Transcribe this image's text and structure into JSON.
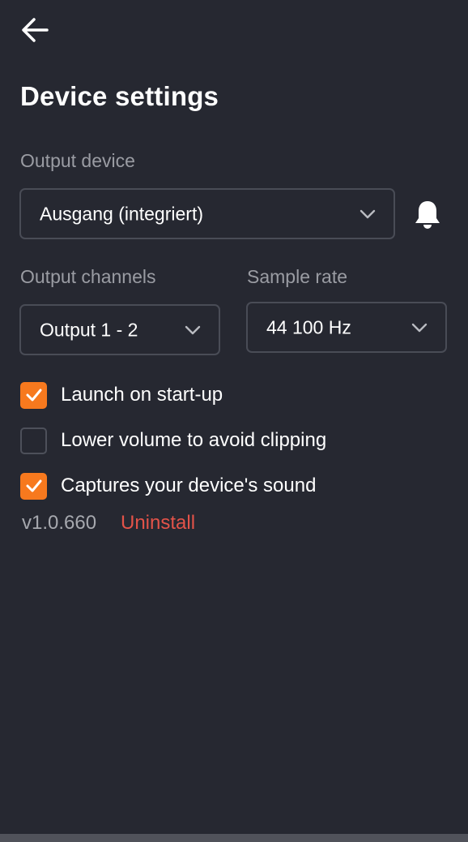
{
  "header": {
    "back_icon": "arrow-left-icon",
    "title": "Device settings"
  },
  "output_device": {
    "label": "Output device",
    "selected": "Ausgang (integriert)",
    "bell_icon": "bell-icon"
  },
  "output_channels": {
    "label": "Output channels",
    "selected": "Output 1 - 2"
  },
  "sample_rate": {
    "label": "Sample rate",
    "selected": "44 100 Hz"
  },
  "options": [
    {
      "label": "Launch on start-up",
      "checked": true
    },
    {
      "label": "Lower volume to avoid clipping",
      "checked": false
    },
    {
      "label": "Captures your device's sound",
      "checked": true
    }
  ],
  "footer": {
    "version": "v1.0.660",
    "uninstall_label": "Uninstall"
  },
  "colors": {
    "background": "#262831",
    "accent": "#f7791e",
    "danger": "#e35349",
    "muted_text": "#9a9ca3",
    "border": "#494c56"
  }
}
